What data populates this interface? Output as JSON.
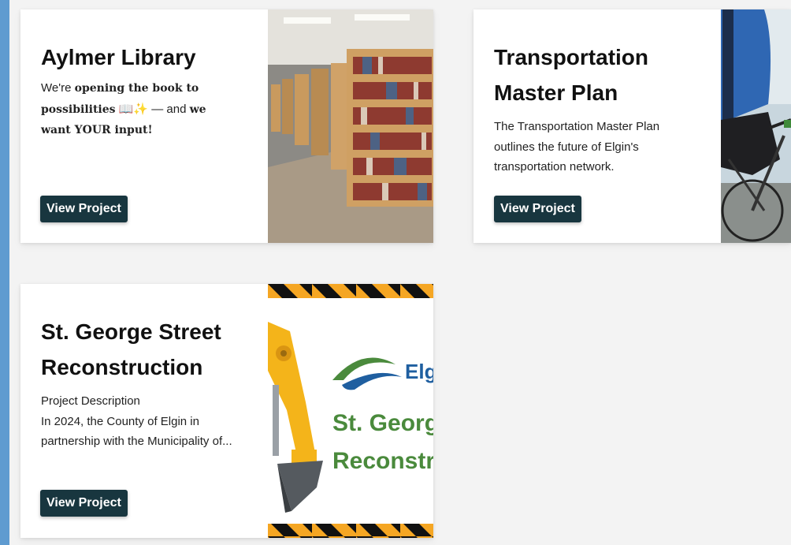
{
  "cards": [
    {
      "title": "Aylmer Library",
      "desc_p1": "We're ",
      "desc_b1": "opening the book to possibilities",
      "desc_icons": " 📖✨ ",
      "desc_p2": "— and ",
      "desc_b2": "we want YOUR input!",
      "button": "View Project",
      "image": "library-bookshelves-photo"
    },
    {
      "title_line1": "Transportation",
      "title_line2": "Master Plan",
      "desc": "The Transportation Master Plan outlines the future of Elgin's transportation network.",
      "button": "View Project",
      "image": "cyclist-photo"
    },
    {
      "title_line1": "St. George Street",
      "title_line2": "Reconstruction",
      "desc_line1": "Project Description",
      "desc_rest": "In 2024, the County of Elgin in partnership with the Municipality of...",
      "button": "View Project",
      "image": "excavator-graphic",
      "image_text": {
        "logo": "Elgin",
        "line1": "St. George",
        "line2": "Reconstruction"
      }
    }
  ],
  "colors": {
    "button_bg": "#18363f",
    "page_bg": "#f3f3f3",
    "accent_strip": "#5f9bd0",
    "elgin_green": "#4a8a3c",
    "elgin_blue": "#1f5fa0",
    "hazard_yellow": "#f5a623"
  }
}
